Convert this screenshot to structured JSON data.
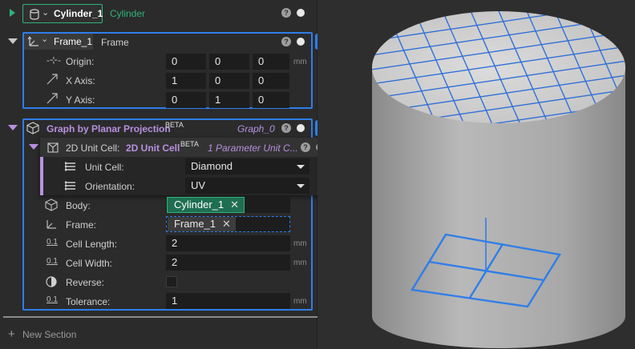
{
  "sections": {
    "cylinder": {
      "name": "Cylinder_1",
      "label": "Cylinder"
    },
    "frame": {
      "name": "Frame_1",
      "label": "Frame",
      "origin_label": "Origin:",
      "xaxis_label": "X Axis:",
      "yaxis_label": "Y Axis:",
      "origin": [
        "0",
        "0",
        "0"
      ],
      "xaxis": [
        "1",
        "0",
        "0"
      ],
      "yaxis": [
        "0",
        "1",
        "0"
      ],
      "unit": "mm"
    },
    "graph": {
      "title": "Graph by Planar Projection",
      "badge": "BETA",
      "name": "Graph_0",
      "unitcell": {
        "label": "2D Unit Cell:",
        "title": "2D Unit Cell",
        "badge": "BETA",
        "subtitle": "1 Parameter Unit C...",
        "cell_label": "Unit Cell:",
        "cell_value": "Diamond",
        "orientation_label": "Orientation:",
        "orientation_value": "UV"
      },
      "body_label": "Body:",
      "body_value": "Cylinder_1",
      "frame_label": "Frame:",
      "frame_value": "Frame_1",
      "cell_length_label": "Cell Length:",
      "cell_length": "2",
      "cell_width_label": "Cell Width:",
      "cell_width": "2",
      "reverse_label": "Reverse:",
      "tolerance_label": "Tolerance:",
      "tolerance": "1",
      "unit": "mm",
      "param_icon": "0.1"
    }
  },
  "footer": {
    "new_section": "New Section"
  },
  "colors": {
    "accent": "#2f7ee8",
    "green": "#2fb37a",
    "purple": "#b790e0"
  }
}
